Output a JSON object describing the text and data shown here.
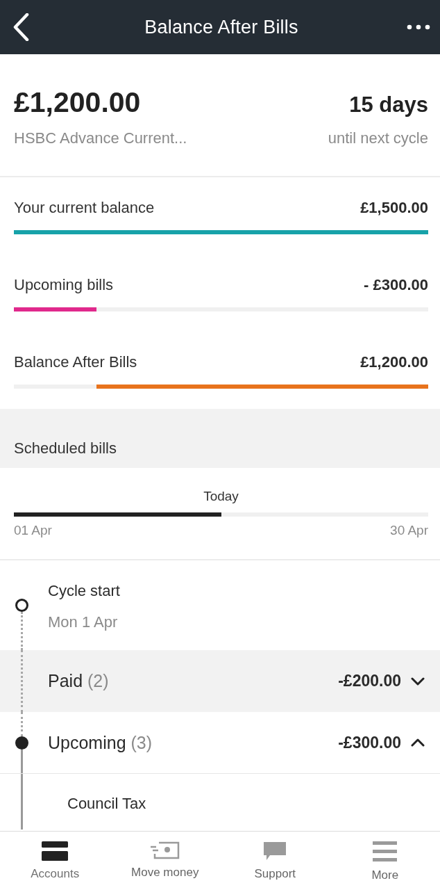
{
  "header": {
    "title": "Balance After Bills"
  },
  "summary": {
    "amount": "£1,200.00",
    "account": "HSBC Advance Current...",
    "days": "15 days",
    "days_caption": "until next cycle"
  },
  "balances": [
    {
      "label": "Your current balance",
      "value": "£1,500.00",
      "level": 1,
      "color": "#17a2a9",
      "kind": "start"
    },
    {
      "label": "Upcoming bills",
      "value": "- £300.00",
      "level": 0.2,
      "color": "#e0298c",
      "kind": "start"
    },
    {
      "label": "Balance After Bills",
      "value": "£1,200.00",
      "level": 0.8,
      "color": "#e8731c",
      "kind": "end"
    }
  ],
  "scheduled": {
    "title": "Scheduled bills",
    "marker_label": "Today",
    "level": 0.5,
    "start_label": "01 Apr",
    "end_label": "30 Apr"
  },
  "timeline": {
    "cycle_start": {
      "title": "Cycle start",
      "date": "Mon 1 Apr"
    },
    "groups": [
      {
        "kind": "paid",
        "title": "Paid",
        "count": "(2)",
        "total": "-£200.00",
        "expanded": false
      },
      {
        "kind": "upcoming",
        "title": "Upcoming",
        "count": "(3)",
        "total": "-£300.00",
        "expanded": true,
        "items": [
          {
            "name": "Council Tax"
          }
        ]
      }
    ]
  },
  "tab_bar": [
    {
      "kind": "accounts",
      "label": "Accounts",
      "selected": true
    },
    {
      "kind": "transfer",
      "label": "Move money",
      "selected": false
    },
    {
      "kind": "support",
      "label": "Support",
      "selected": false
    },
    {
      "kind": "more",
      "label": "More",
      "selected": false
    }
  ]
}
